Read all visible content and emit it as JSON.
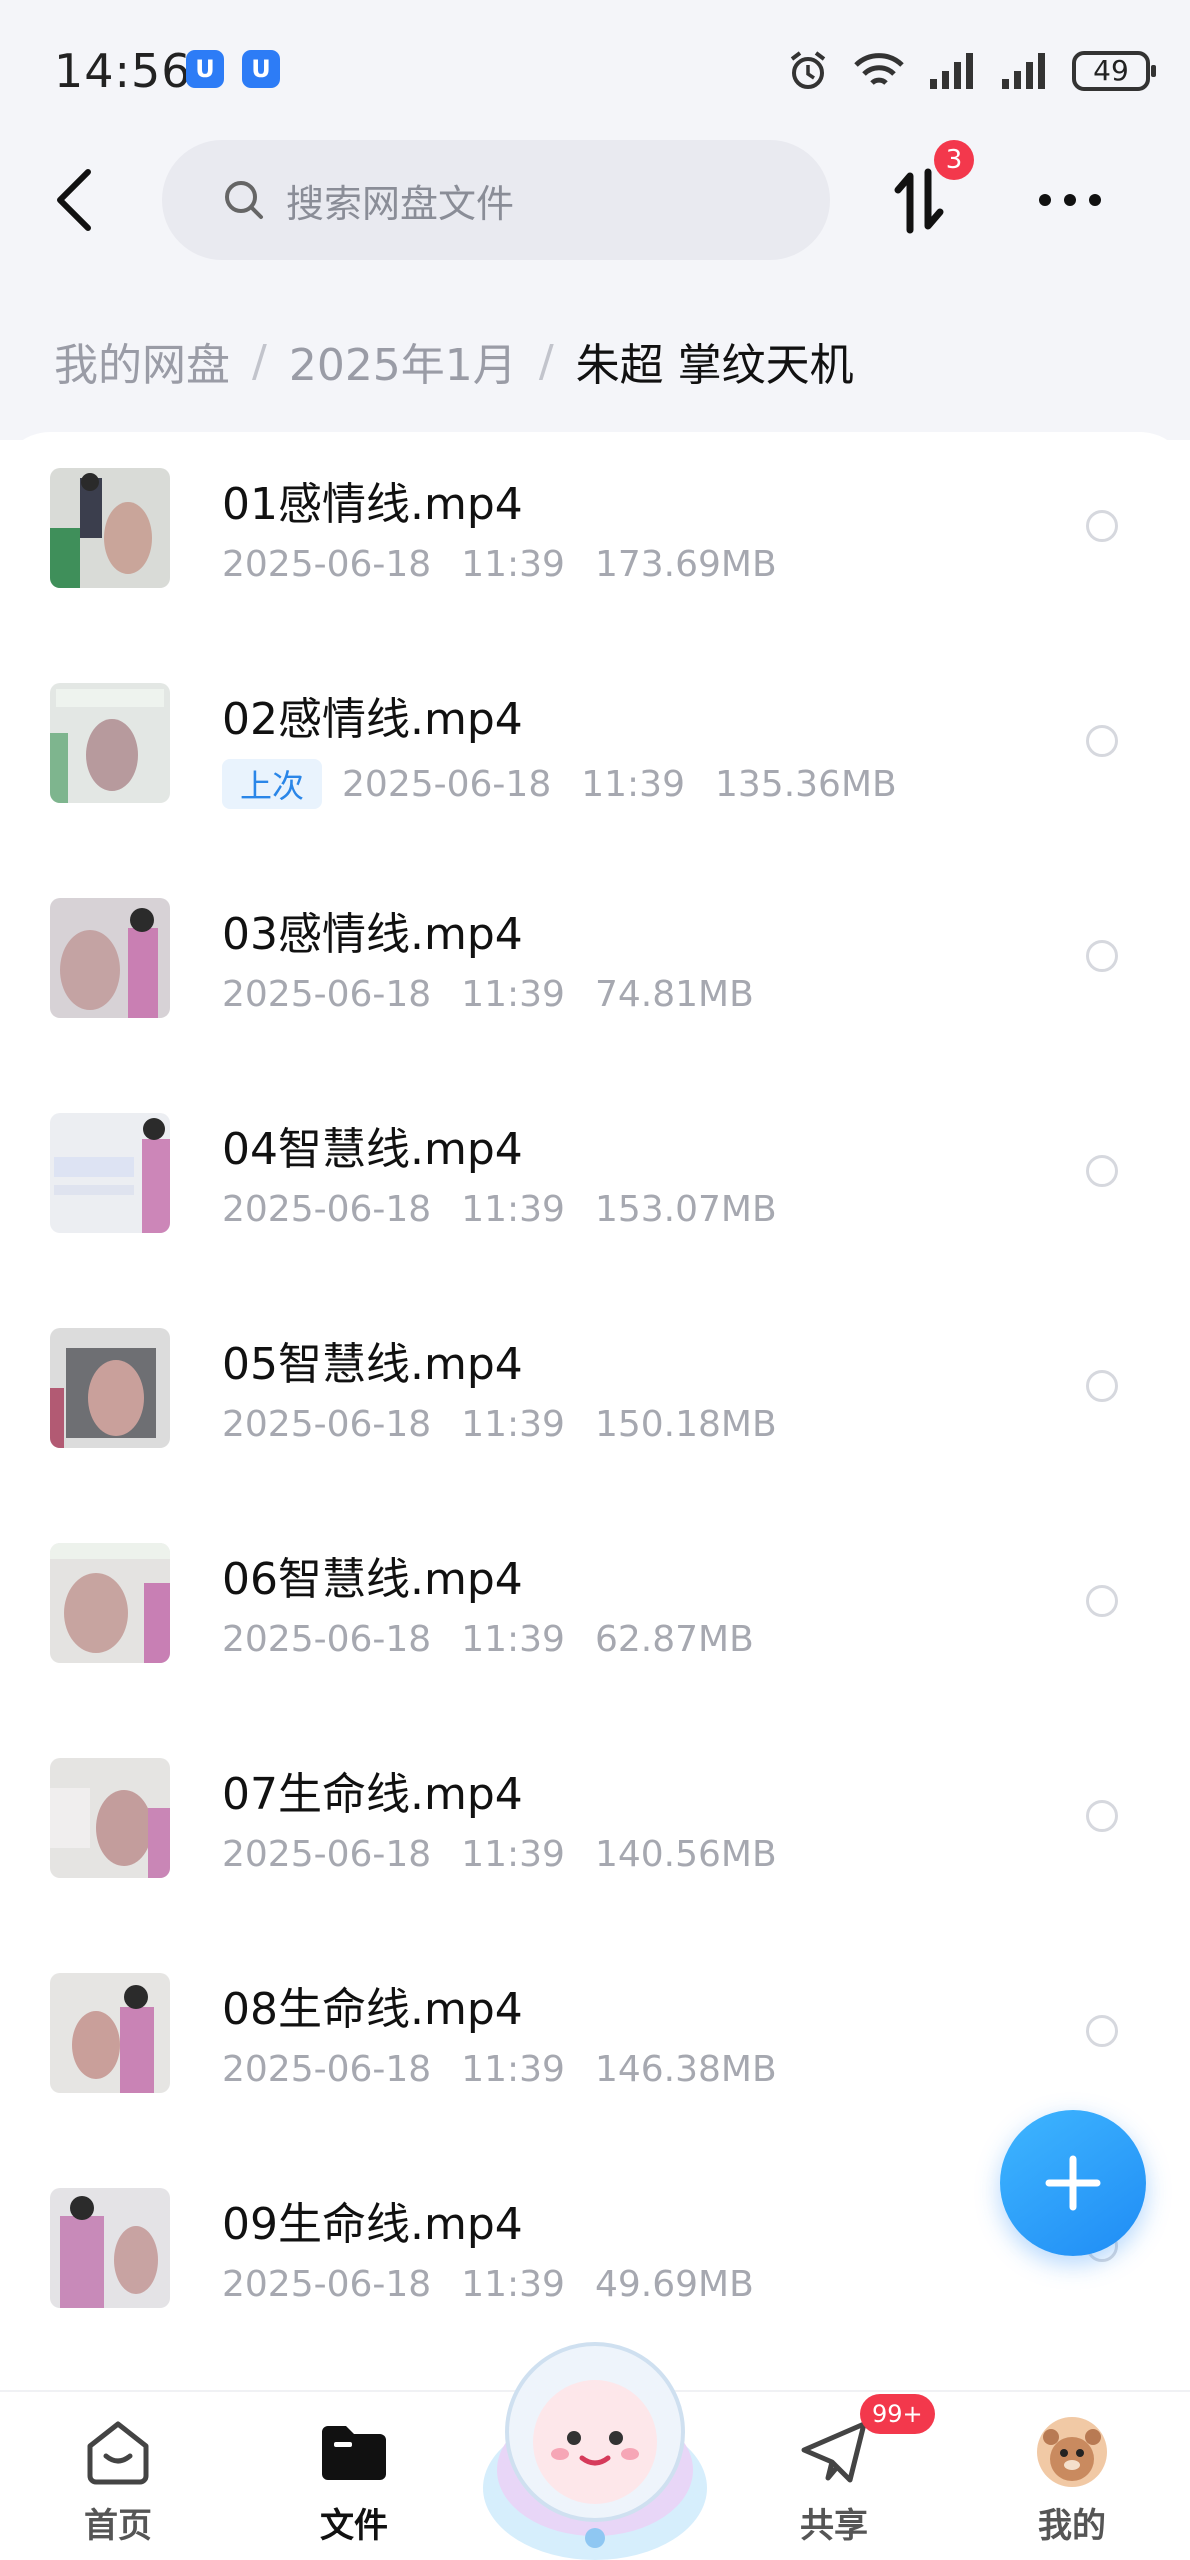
{
  "status_bar": {
    "time": "14:56",
    "app_badges": [
      "U",
      "U"
    ],
    "battery": "49"
  },
  "header": {
    "search_placeholder": "搜索网盘文件",
    "transfer_badge": "3"
  },
  "breadcrumb": {
    "items": [
      "我的网盘",
      "2025年1月"
    ],
    "current": "朱超  掌纹天机"
  },
  "files": [
    {
      "name": "01感情线.mp4",
      "date": "2025-06-18",
      "time": "11:39",
      "size": "173.69MB",
      "tag": ""
    },
    {
      "name": "02感情线.mp4",
      "date": "2025-06-18",
      "time": "11:39",
      "size": "135.36MB",
      "tag": "上次"
    },
    {
      "name": "03感情线.mp4",
      "date": "2025-06-18",
      "time": "11:39",
      "size": "74.81MB",
      "tag": ""
    },
    {
      "name": "04智慧线.mp4",
      "date": "2025-06-18",
      "time": "11:39",
      "size": "153.07MB",
      "tag": ""
    },
    {
      "name": "05智慧线.mp4",
      "date": "2025-06-18",
      "time": "11:39",
      "size": "150.18MB",
      "tag": ""
    },
    {
      "name": "06智慧线.mp4",
      "date": "2025-06-18",
      "time": "11:39",
      "size": "62.87MB",
      "tag": ""
    },
    {
      "name": "07生命线.mp4",
      "date": "2025-06-18",
      "time": "11:39",
      "size": "140.56MB",
      "tag": ""
    },
    {
      "name": "08生命线.mp4",
      "date": "2025-06-18",
      "time": "11:39",
      "size": "146.38MB",
      "tag": ""
    },
    {
      "name": "09生命线.mp4",
      "date": "2025-06-18",
      "time": "11:39",
      "size": "49.69MB",
      "tag": ""
    }
  ],
  "bottom_nav": {
    "home": "首页",
    "files": "文件",
    "share": "共享",
    "share_badge": "99+",
    "me": "我的"
  },
  "colors": {
    "accent": "#2d7cf6",
    "badge": "#f3384c",
    "fab": "#1f8cf5"
  }
}
